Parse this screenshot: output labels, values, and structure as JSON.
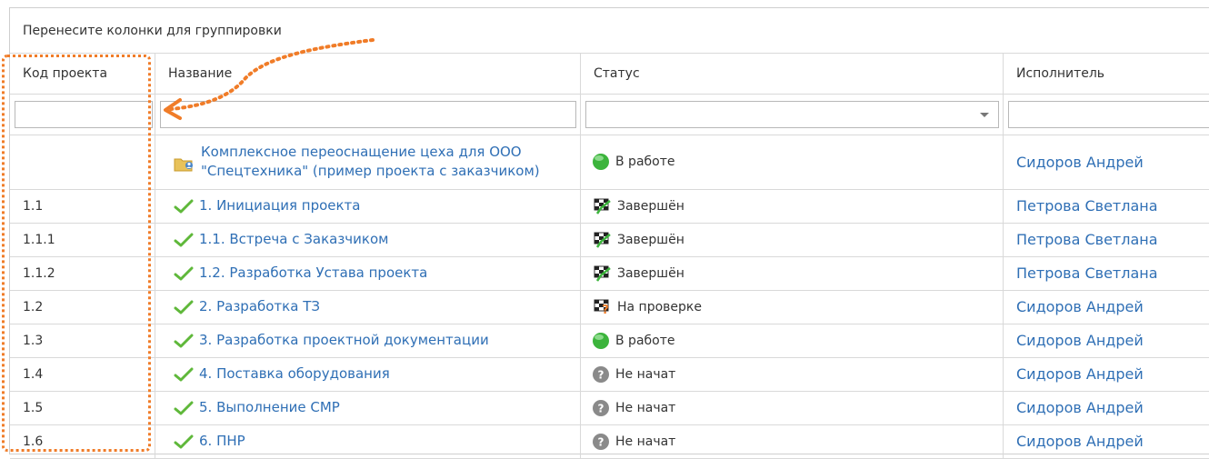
{
  "group_panel": {
    "text": "Перенесите колонки для группировки"
  },
  "columns": [
    {
      "label": "Код проекта"
    },
    {
      "label": "Название"
    },
    {
      "label": "Статус"
    },
    {
      "label": "Исполнитель"
    }
  ],
  "rows": [
    {
      "code": "",
      "name": "Комплексное переоснащение цеха для ООО \"Спецтехника\" (пример проекта с заказчиком)",
      "name_icon": "project-folder-icon",
      "status": "В работе",
      "status_icon": "green-circle-icon",
      "executor": "Сидоров Андрей"
    },
    {
      "code": "1.1",
      "name": "1. Инициация проекта",
      "name_icon": "check-icon",
      "status": "Завершён",
      "status_icon": "checkered-flag-icon",
      "executor": "Петрова Светлана"
    },
    {
      "code": "1.1.1",
      "name": "1.1. Встреча с Заказчиком",
      "name_icon": "check-icon",
      "status": "Завершён",
      "status_icon": "checkered-flag-icon",
      "executor": "Петрова Светлана"
    },
    {
      "code": "1.1.2",
      "name": "1.2. Разработка Устава проекта",
      "name_icon": "check-icon",
      "status": "Завершён",
      "status_icon": "checkered-flag-icon",
      "executor": "Петрова Светлана"
    },
    {
      "code": "1.2",
      "name": "2. Разработка ТЗ",
      "name_icon": "check-icon",
      "status": "На проверке",
      "status_icon": "review-flag-icon",
      "executor": "Сидоров Андрей"
    },
    {
      "code": "1.3",
      "name": "3. Разработка проектной документации",
      "name_icon": "check-icon",
      "status": "В работе",
      "status_icon": "green-circle-icon",
      "executor": "Сидоров Андрей"
    },
    {
      "code": "1.4",
      "name": "4. Поставка оборудования",
      "name_icon": "check-icon",
      "status": "Не начат",
      "status_icon": "gray-question-icon",
      "executor": "Сидоров Андрей"
    },
    {
      "code": "1.5",
      "name": "5. Выполнение СМР",
      "name_icon": "check-icon",
      "status": "Не начат",
      "status_icon": "gray-question-icon",
      "executor": "Сидоров Андрей"
    },
    {
      "code": "1.6",
      "name": "6. ПНР",
      "name_icon": "check-icon",
      "status": "Не начат",
      "status_icon": "gray-question-icon",
      "executor": "Сидоров Андрей"
    }
  ],
  "colors": {
    "link": "#2f6fb5",
    "annotation": "#f07c28",
    "grid_line": "#d9d9d9"
  }
}
